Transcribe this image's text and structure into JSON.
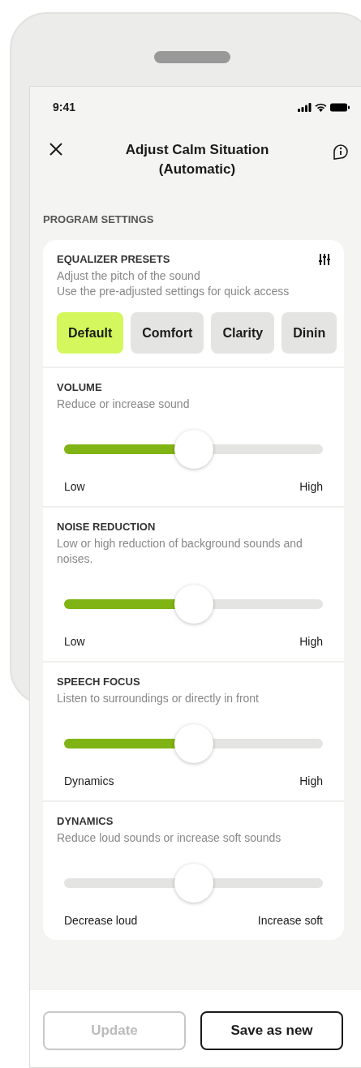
{
  "status_bar": {
    "time": "9:41"
  },
  "header": {
    "title": "Adjust Calm Situation (Automatic)"
  },
  "section_title": "PROGRAM SETTINGS",
  "equalizer": {
    "title": "EQUALIZER PRESETS",
    "description": [
      "Adjust the pitch of the sound",
      "Use the pre-adjusted settings for quick access"
    ],
    "presets": [
      {
        "label": "Default",
        "selected": true
      },
      {
        "label": "Comfort",
        "selected": false
      },
      {
        "label": "Clarity",
        "selected": false
      },
      {
        "label": "Dinin",
        "selected": false
      }
    ]
  },
  "sliders": [
    {
      "title": "VOLUME",
      "description": "Reduce or increase sound",
      "level": 0.5,
      "fill_shown": true,
      "min_label": "Low",
      "max_label": "High"
    },
    {
      "title": "NOISE REDUCTION",
      "description": "Low or high reduction of background sounds and noises.",
      "level": 0.5,
      "fill_shown": true,
      "min_label": "Low",
      "max_label": "High"
    },
    {
      "title": "SPEECH FOCUS",
      "description": "Listen to surroundings or directly in front",
      "level": 0.5,
      "fill_shown": true,
      "min_label": "Dynamics",
      "max_label": "High"
    },
    {
      "title": "DYNAMICS",
      "description": "Reduce loud sounds or increase soft sounds",
      "level": 0.5,
      "fill_shown": false,
      "min_label": "Decrease loud",
      "max_label": "Increase soft"
    }
  ],
  "buttons": [
    {
      "label": "Update",
      "disabled": true
    },
    {
      "label": "Save as new",
      "disabled": false
    }
  ]
}
